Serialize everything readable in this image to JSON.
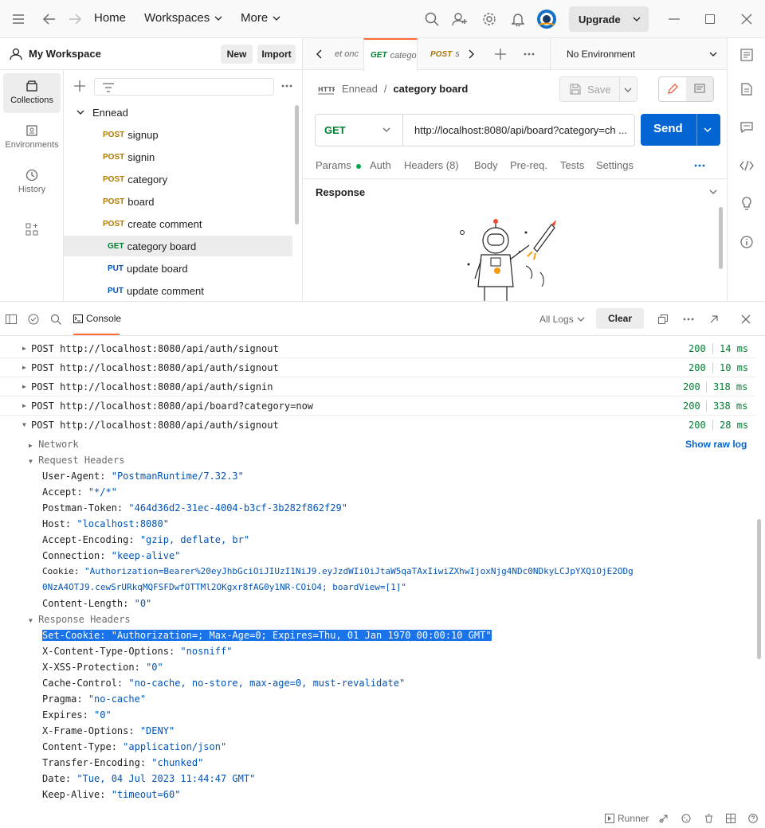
{
  "topbar": {
    "home": "Home",
    "workspaces": "Workspaces",
    "more": "More",
    "upgrade": "Upgrade"
  },
  "sidebar": {
    "workspace_title": "My Workspace",
    "new_label": "New",
    "import_label": "Import",
    "nav": [
      "Collections",
      "Environments",
      "History"
    ],
    "collection_name": "Ennead",
    "items": [
      {
        "method": "POST",
        "label": "signup"
      },
      {
        "method": "POST",
        "label": "signin"
      },
      {
        "method": "POST",
        "label": "category"
      },
      {
        "method": "POST",
        "label": "board"
      },
      {
        "method": "POST",
        "label": "create comment"
      },
      {
        "method": "GET",
        "label": "category board"
      },
      {
        "method": "PUT",
        "label": "update board"
      },
      {
        "method": "PUT",
        "label": "update comment"
      }
    ]
  },
  "tabs": [
    {
      "method": "",
      "label": "et onc"
    },
    {
      "method": "GET",
      "label": "catego"
    },
    {
      "method": "POST",
      "label": "s"
    }
  ],
  "environment": "No Environment",
  "request": {
    "breadcrumb_collection": "Ennead",
    "breadcrumb_sep": "/",
    "breadcrumb_name": "category board",
    "save_label": "Save",
    "method": "GET",
    "url": "http://localhost:8080/api/board?category=ch ...",
    "send_label": "Send",
    "tabs": [
      "Params",
      "Auth",
      "Headers (8)",
      "Body",
      "Pre-req.",
      "Tests",
      "Settings"
    ],
    "response_label": "Response"
  },
  "console": {
    "tab_label": "Console",
    "filter": "All Logs",
    "clear_label": "Clear",
    "logs": [
      {
        "method": "POST",
        "url": "http://localhost:8080/api/auth/signout",
        "status": "200",
        "time": "14 ms"
      },
      {
        "method": "POST",
        "url": "http://localhost:8080/api/auth/signout",
        "status": "200",
        "time": "10 ms"
      },
      {
        "method": "POST",
        "url": "http://localhost:8080/api/auth/signin",
        "status": "200",
        "time": "318 ms"
      },
      {
        "method": "POST",
        "url": "http://localhost:8080/api/board?category=now",
        "status": "200",
        "time": "338 ms"
      },
      {
        "method": "POST",
        "url": "http://localhost:8080/api/auth/signout",
        "status": "200",
        "time": "28 ms"
      }
    ],
    "network_label": "Network",
    "show_raw_log": "Show raw log",
    "request_headers_label": "Request Headers",
    "request_headers": [
      {
        "key": "User-Agent:",
        "value": "\"PostmanRuntime/7.32.3\""
      },
      {
        "key": "Accept:",
        "value": "\"*/*\""
      },
      {
        "key": "Postman-Token:",
        "value": "\"464d36d2-31ec-4004-b3cf-3b282f862f29\""
      },
      {
        "key": "Host:",
        "value": "\"localhost:8080\""
      },
      {
        "key": "Accept-Encoding:",
        "value": "\"gzip, deflate, br\""
      },
      {
        "key": "Connection:",
        "value": "\"keep-alive\""
      },
      {
        "key": "Cookie:",
        "value": "\"Authorization=Bearer%20eyJhbGciOiJIUzI1NiJ9.eyJzdWIiOiJtaW5qaTAxIiwiZXhwIjoxNjg4NDc0NDkyLCJpYXQiOjE2ODg"
      },
      {
        "key": "",
        "value": "0NzA4OTJ9.cewSrURkqMQFSFDwfOTTMl2OKgxr8fAG0y1NR-COiO4; boardView=[1]\""
      },
      {
        "key": "Content-Length:",
        "value": "\"0\""
      }
    ],
    "response_headers_label": "Response Headers",
    "response_headers": [
      {
        "key": "Set-Cookie:",
        "value": "\"Authorization=; Max-Age=0; Expires=Thu, 01 Jan 1970 00:00:10 GMT\""
      },
      {
        "key": "X-Content-Type-Options:",
        "value": "\"nosniff\""
      },
      {
        "key": "X-XSS-Protection:",
        "value": "\"0\""
      },
      {
        "key": "Cache-Control:",
        "value": "\"no-cache, no-store, max-age=0, must-revalidate\""
      },
      {
        "key": "Pragma:",
        "value": "\"no-cache\""
      },
      {
        "key": "Expires:",
        "value": "\"0\""
      },
      {
        "key": "X-Frame-Options:",
        "value": "\"DENY\""
      },
      {
        "key": "Content-Type:",
        "value": "\"application/json\""
      },
      {
        "key": "Transfer-Encoding:",
        "value": "\"chunked\""
      },
      {
        "key": "Date:",
        "value": "\"Tue, 04 Jul 2023 11:44:47 GMT\""
      },
      {
        "key": "Keep-Alive:",
        "value": "\"timeout=60\""
      }
    ]
  },
  "statusbar": {
    "runner": "Runner"
  },
  "colors": {
    "accent": "#ff6c37",
    "send": "#0265d2",
    "post": "#ad7a03",
    "get": "#007f31",
    "put": "#0053b8",
    "selection": "#1a73e8"
  }
}
